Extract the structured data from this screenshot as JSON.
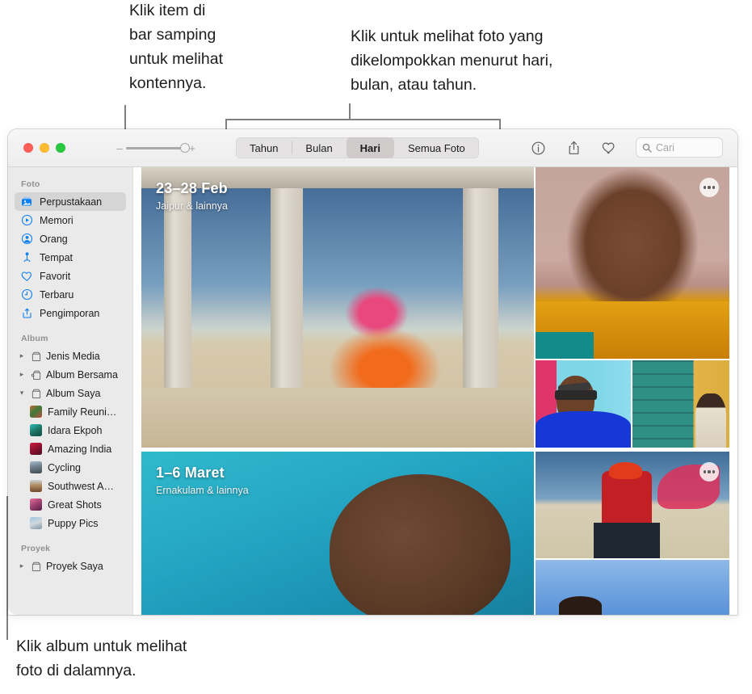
{
  "callouts": [
    {
      "id": "sidebar",
      "text": "Klik item di\nbar samping\nuntuk melihat\nkontennya."
    },
    {
      "id": "segment",
      "text": "Klik untuk melihat foto yang\ndikelompokkan menurut hari,\nbulan, atau tahun."
    },
    {
      "id": "album",
      "text": "Klik album untuk melihat\nfoto di dalamnya."
    }
  ],
  "window": {
    "traffic_lights": [
      "close",
      "minimize",
      "zoom"
    ],
    "zoom_slider": {
      "minus": "–",
      "plus": "+",
      "value": 82
    },
    "segmented_control": {
      "options": [
        "Tahun",
        "Bulan",
        "Hari",
        "Semua Foto"
      ],
      "selected": "Hari"
    },
    "tool_icons": [
      "info-icon",
      "share-icon",
      "favorite-heart-icon",
      "rotate-icon"
    ],
    "search": {
      "placeholder": "Cari",
      "value": "",
      "icon": "search-icon"
    }
  },
  "sidebar": {
    "sections": [
      {
        "header": "Foto",
        "items": [
          {
            "label": "Perpustakaan",
            "icon": "library-icon",
            "selected": true
          },
          {
            "label": "Memori",
            "icon": "memories-icon",
            "selected": false
          },
          {
            "label": "Orang",
            "icon": "people-icon",
            "selected": false
          },
          {
            "label": "Tempat",
            "icon": "places-icon",
            "selected": false
          },
          {
            "label": "Favorit",
            "icon": "heart-icon",
            "selected": false
          },
          {
            "label": "Terbaru",
            "icon": "recents-clock-icon",
            "selected": false
          },
          {
            "label": "Pengimporan",
            "icon": "import-icon",
            "selected": false
          }
        ]
      },
      {
        "header": "Album",
        "items": [
          {
            "label": "Jenis Media",
            "icon": "folder-icon",
            "disclosure": "collapsed"
          },
          {
            "label": "Album Bersama",
            "icon": "shared-folder-icon",
            "disclosure": "collapsed"
          },
          {
            "label": "Album Saya",
            "icon": "folder-icon",
            "disclosure": "expanded"
          },
          {
            "label": "Family Reuni…",
            "icon": "album-thumbnail",
            "child": true
          },
          {
            "label": "Idara Ekpoh",
            "icon": "album-thumbnail",
            "child": true
          },
          {
            "label": "Amazing India",
            "icon": "album-thumbnail",
            "child": true
          },
          {
            "label": "Cycling",
            "icon": "album-thumbnail",
            "child": true
          },
          {
            "label": "Southwest A…",
            "icon": "album-thumbnail",
            "child": true
          },
          {
            "label": "Great Shots",
            "icon": "album-thumbnail",
            "child": true
          },
          {
            "label": "Puppy Pics",
            "icon": "album-thumbnail",
            "child": true
          }
        ]
      },
      {
        "header": "Proyek",
        "items": [
          {
            "label": "Proyek Saya",
            "icon": "folder-icon",
            "disclosure": "collapsed"
          }
        ]
      }
    ]
  },
  "content": {
    "groups": [
      {
        "title": "23–28 Feb",
        "subtitle": "Jaipur & lainnya"
      },
      {
        "title": "1–6 Maret",
        "subtitle": "Ernakulam & lainnya"
      }
    ]
  },
  "colors": {
    "accent_blue": "#0a7ff2",
    "sidebar_bg": "#eaeaea",
    "selected_row": "#d6d5d6",
    "toolbar_bg": "#f1f0f1",
    "leader_line": "#808080"
  }
}
